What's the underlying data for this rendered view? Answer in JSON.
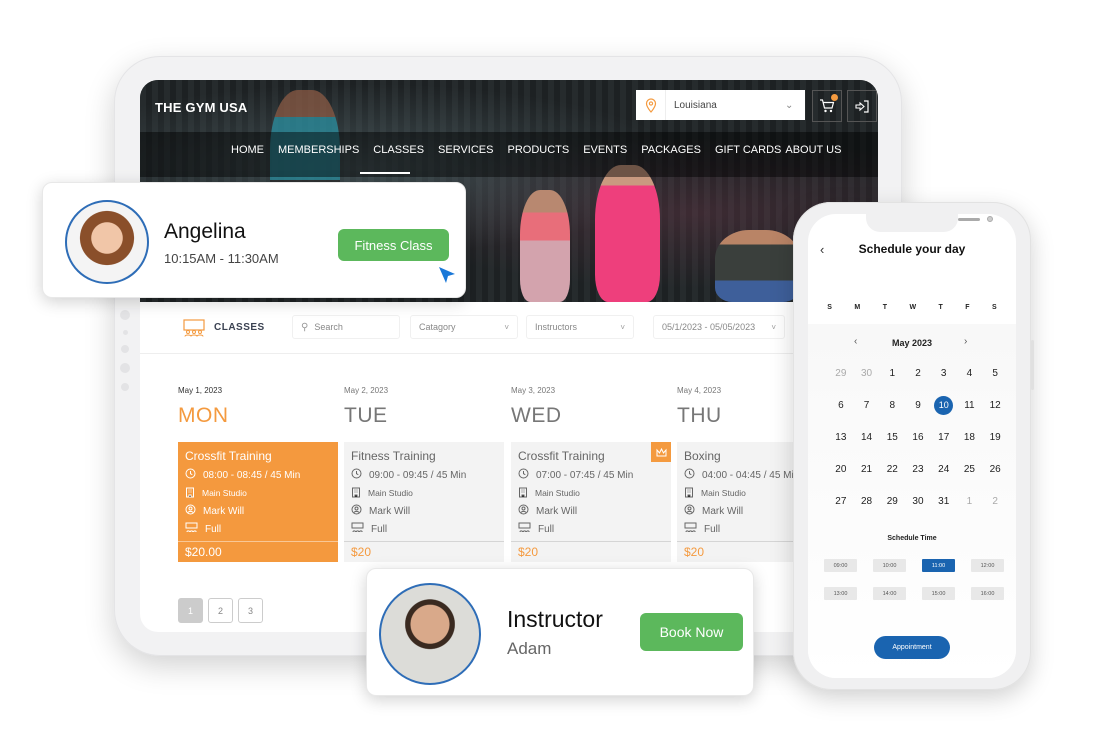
{
  "site": {
    "brand": "THE GYM USA",
    "location": {
      "selected": "Louisiana",
      "icon": "map-pin-icon"
    },
    "cart": {
      "icon": "cart-icon",
      "badge": "1"
    },
    "login": {
      "icon": "login-icon"
    },
    "nav": [
      "HOME",
      "MEMBERSHIPS",
      "CLASSES",
      "SERVICES",
      "PRODUCTS",
      "EVENTS",
      "PACKAGES",
      "GIFT CARDS",
      "ABOUT US"
    ],
    "active_nav": "CLASSES"
  },
  "filters": {
    "section_label": "CLASSES",
    "search_placeholder": "Search",
    "category": "Catagory",
    "instructors": "Instructors",
    "date_range": "05/1/2023 - 05/05/2023"
  },
  "schedule": [
    {
      "date": "May 1, 2023",
      "day": "MON",
      "active": true,
      "class": {
        "title": "Crossfit Training",
        "time": "08:00 - 08:45 / 45 Min",
        "studio": "Main Studio",
        "instructor": "Mark Will",
        "status": "Full",
        "price": "$20.00",
        "premium": false
      }
    },
    {
      "date": "May 2, 2023",
      "day": "TUE",
      "active": false,
      "class": {
        "title": "Fitness Training",
        "time": "09:00 - 09:45 / 45 Min",
        "studio": "Main Studio",
        "instructor": "Mark Will",
        "status": "Full",
        "price": "$20",
        "premium": false
      }
    },
    {
      "date": "May 3, 2023",
      "day": "WED",
      "active": false,
      "class": {
        "title": "Crossfit Training",
        "time": "07:00 - 07:45 / 45 Min",
        "studio": "Main Studio",
        "instructor": "Mark Will",
        "status": "Full",
        "price": "$20",
        "premium": true
      }
    },
    {
      "date": "May 4, 2023",
      "day": "THU",
      "active": false,
      "class": {
        "title": "Boxing",
        "time": "04:00 - 04:45 / 45 Min",
        "studio": "Main Studio",
        "instructor": "Mark Will",
        "status": "Full",
        "price": "$20",
        "premium": false
      }
    }
  ],
  "pagination": {
    "pages": [
      "1",
      "2",
      "3"
    ],
    "current": "1"
  },
  "booking_card": {
    "name": "Angelina",
    "time": "10:15AM - 11:30AM",
    "button": "Fitness Class"
  },
  "instructor_card": {
    "title": "Instructor",
    "name": "Adam",
    "button": "Book Now"
  },
  "phone": {
    "title": "Schedule your day",
    "weekdays": [
      "S",
      "M",
      "T",
      "W",
      "T",
      "F",
      "S"
    ],
    "month": "May 2023",
    "days": [
      {
        "d": "29",
        "muted": true
      },
      {
        "d": "30",
        "muted": true
      },
      {
        "d": "1"
      },
      {
        "d": "2"
      },
      {
        "d": "3"
      },
      {
        "d": "4"
      },
      {
        "d": "5"
      },
      {
        "d": "6"
      },
      {
        "d": "7"
      },
      {
        "d": "8"
      },
      {
        "d": "9"
      },
      {
        "d": "10",
        "selected": true
      },
      {
        "d": "11"
      },
      {
        "d": "12"
      },
      {
        "d": "13"
      },
      {
        "d": "14"
      },
      {
        "d": "15"
      },
      {
        "d": "16"
      },
      {
        "d": "17"
      },
      {
        "d": "18"
      },
      {
        "d": "19"
      },
      {
        "d": "20"
      },
      {
        "d": "21"
      },
      {
        "d": "22"
      },
      {
        "d": "23"
      },
      {
        "d": "24"
      },
      {
        "d": "25"
      },
      {
        "d": "26"
      },
      {
        "d": "27"
      },
      {
        "d": "28"
      },
      {
        "d": "29"
      },
      {
        "d": "30"
      },
      {
        "d": "31"
      },
      {
        "d": "1",
        "muted": true
      },
      {
        "d": "2",
        "muted": true
      }
    ],
    "schedule_time_label": "Schedule Time",
    "times": [
      "09:00",
      "10:00",
      "11:00",
      "12:00",
      "13:00",
      "14:00",
      "15:00",
      "16:00"
    ],
    "selected_time": "11:00",
    "appointment_button": "Appointment"
  },
  "colors": {
    "accent": "#f49a3f",
    "green": "#5cb85c",
    "blue": "#1a64b0"
  }
}
